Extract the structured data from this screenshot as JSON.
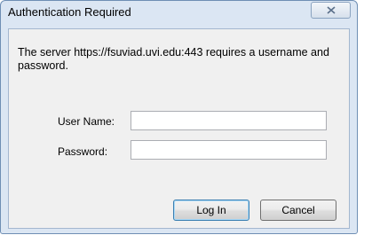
{
  "dialog": {
    "title": "Authentication Required",
    "close_icon": "close-icon",
    "message": "The server https://fsuviad.uvi.edu:443 requires a username and password.",
    "username_label": "User Name:",
    "username_value": "",
    "password_label": "Password:",
    "password_value": "",
    "login_label": "Log In",
    "cancel_label": "Cancel"
  },
  "colors": {
    "frame": "#dbe6f3",
    "content": "#f0f0f0",
    "default_button_border": "#3c7fb1"
  }
}
